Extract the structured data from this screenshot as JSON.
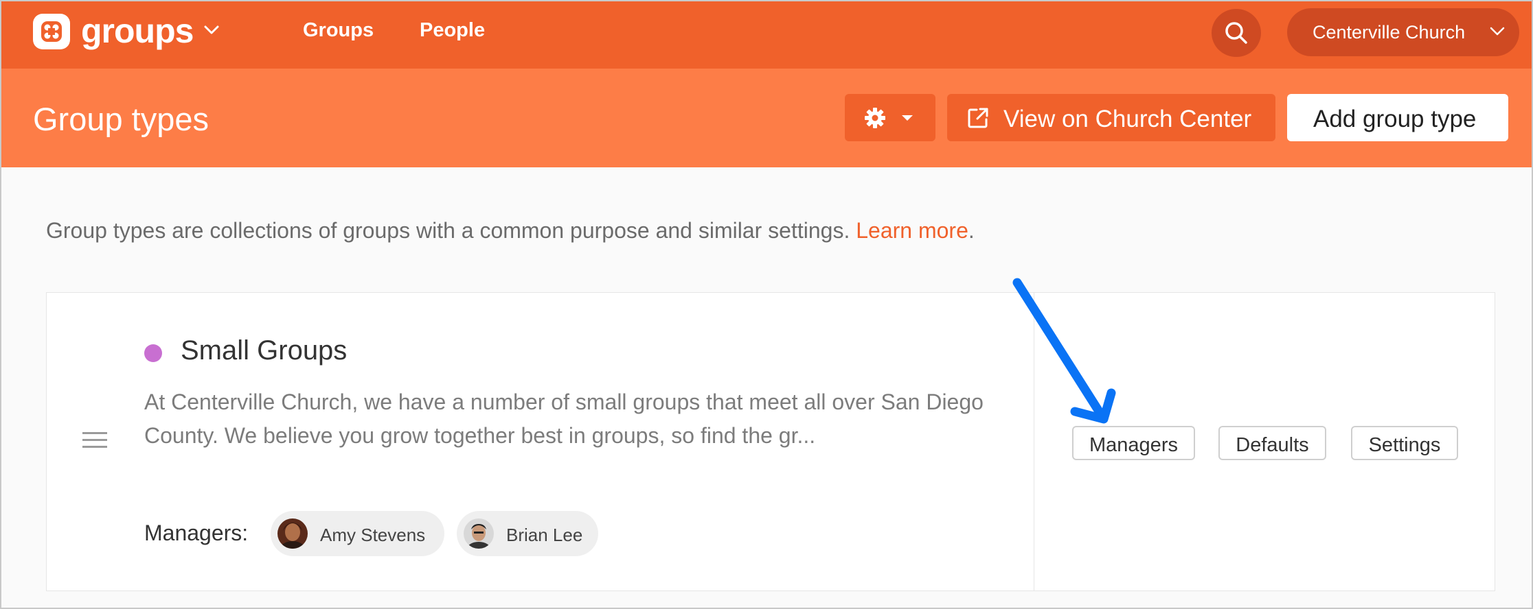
{
  "topnav": {
    "app_name": "groups",
    "links": [
      "Groups",
      "People"
    ],
    "org_name": "Centerville Church"
  },
  "header": {
    "title": "Group types",
    "view_label": "View on Church Center",
    "add_label": "Add group type"
  },
  "intro": {
    "text": "Group types are collections of groups with a common purpose and similar settings.",
    "link": "Learn more",
    "suffix": "."
  },
  "group_type": {
    "name": "Small Groups",
    "color": "#c86fd1",
    "description": "At Centerville Church, we have a number of small groups that meet all over San Diego County. We believe you grow together best in groups, so find the gr...",
    "managers_label": "Managers:",
    "managers": [
      {
        "name": "Amy Stevens"
      },
      {
        "name": "Brian Lee"
      }
    ],
    "actions": [
      "Managers",
      "Defaults",
      "Settings"
    ]
  },
  "colors": {
    "brand": "#f0612b",
    "header": "#fd7d47",
    "annotation": "#0a73f5"
  }
}
